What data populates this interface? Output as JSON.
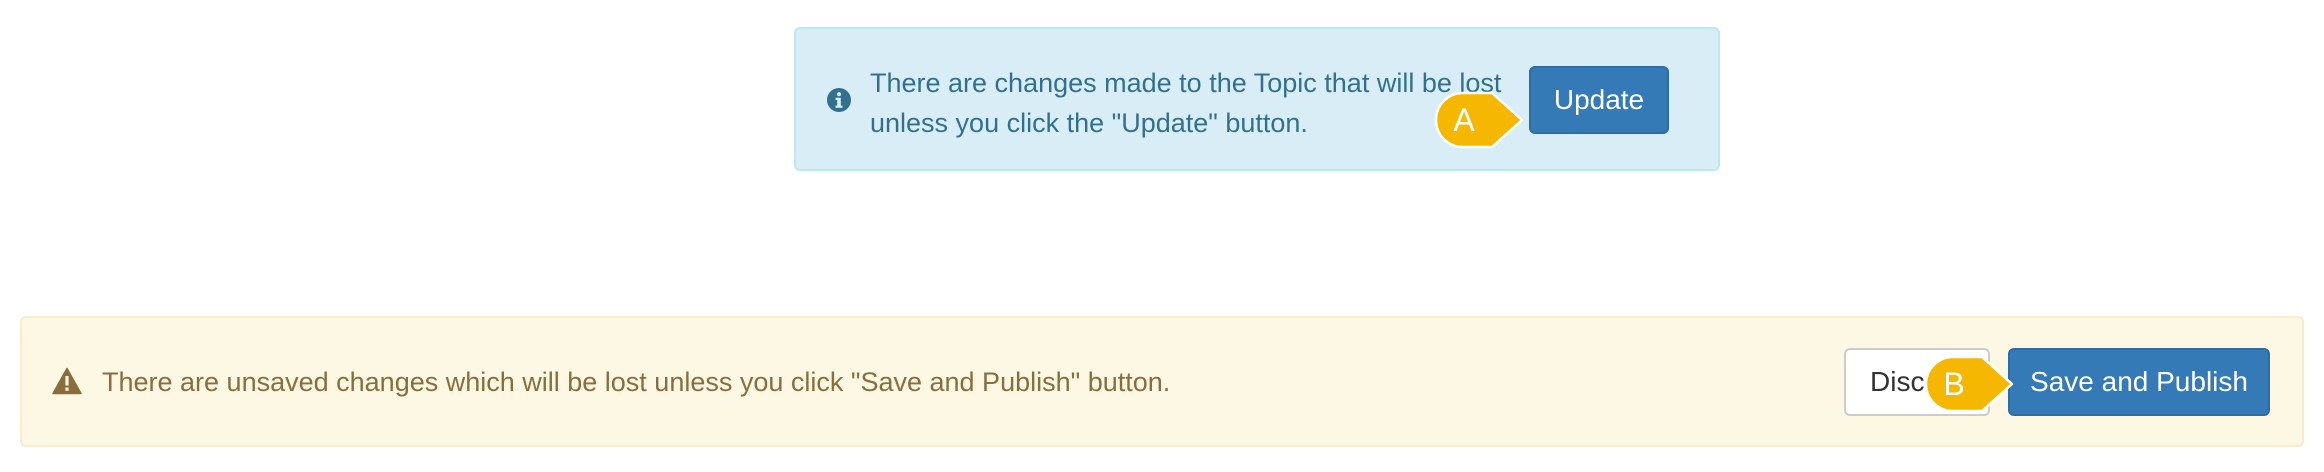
{
  "info_alert": {
    "message": "There are changes made to the Topic that will be lost unless you click the \"Update\" button.",
    "button_label": "Update",
    "icon": "info-circle-icon"
  },
  "warning_alert": {
    "message": "There are unsaved changes which will be lost unless you click \"Save and Publish\" button.",
    "icon": "warning-triangle-icon",
    "discard_label": "Disc",
    "publish_label": "Save and Publish"
  },
  "callouts": {
    "a": "A",
    "b": "B"
  },
  "colors": {
    "info_background": "#d9edf7",
    "info_text": "#31708f",
    "warning_background": "#fcf8e3",
    "warning_text": "#8a6d3b",
    "primary_button": "#337ab7",
    "callout": "#f5b700"
  }
}
